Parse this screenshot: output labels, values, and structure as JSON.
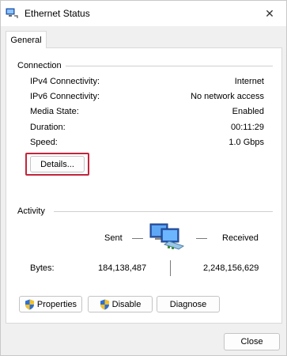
{
  "window": {
    "title": "Ethernet Status",
    "close_glyph": "✕"
  },
  "tab": {
    "label": "General"
  },
  "connection": {
    "title": "Connection",
    "rows": [
      {
        "label": "IPv4 Connectivity:",
        "value": "Internet"
      },
      {
        "label": "IPv6 Connectivity:",
        "value": "No network access"
      },
      {
        "label": "Media State:",
        "value": "Enabled"
      },
      {
        "label": "Duration:",
        "value": "00:11:29"
      },
      {
        "label": "Speed:",
        "value": "1.0 Gbps"
      }
    ],
    "details_label": "Details..."
  },
  "activity": {
    "title": "Activity",
    "sent_label": "Sent",
    "received_label": "Received",
    "bytes_label": "Bytes:",
    "bytes_sent": "184,138,487",
    "bytes_received": "2,248,156,629"
  },
  "buttons": {
    "properties": "Properties",
    "disable": "Disable",
    "diagnose": "Diagnose",
    "close": "Close"
  },
  "colors": {
    "highlight": "#c2253c",
    "shield_blue": "#2f6fd0",
    "shield_yellow": "#f2c12e"
  },
  "icons": [
    "network-icon",
    "close-icon",
    "shield-icon",
    "network-activity-icon"
  ]
}
